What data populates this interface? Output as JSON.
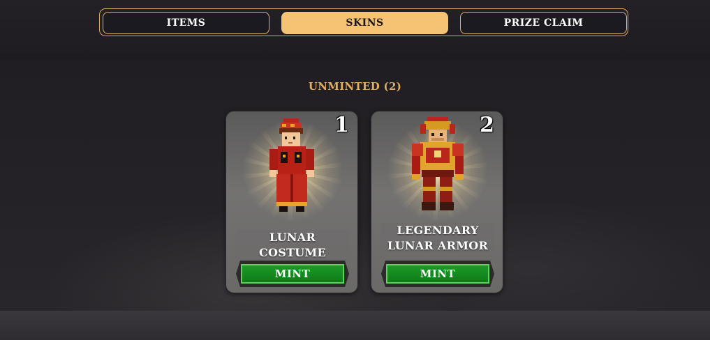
{
  "tabs": [
    {
      "label": "ITEMS",
      "active": false
    },
    {
      "label": "SKINS",
      "active": true
    },
    {
      "label": "PRIZE CLAIM",
      "active": false
    }
  ],
  "section": {
    "title": "UNMINTED (2)"
  },
  "cards": [
    {
      "number": "1",
      "name": "LUNAR COSTUME",
      "button": "MINT",
      "sprite": "lunar-costume-character"
    },
    {
      "number": "2",
      "name": "LEGENDARY LUNAR ARMOR",
      "button": "MINT",
      "sprite": "legendary-lunar-armor-character"
    }
  ],
  "colors": {
    "accent": "#f4c373",
    "title": "#e2ad63",
    "mint_green": "#129222"
  }
}
